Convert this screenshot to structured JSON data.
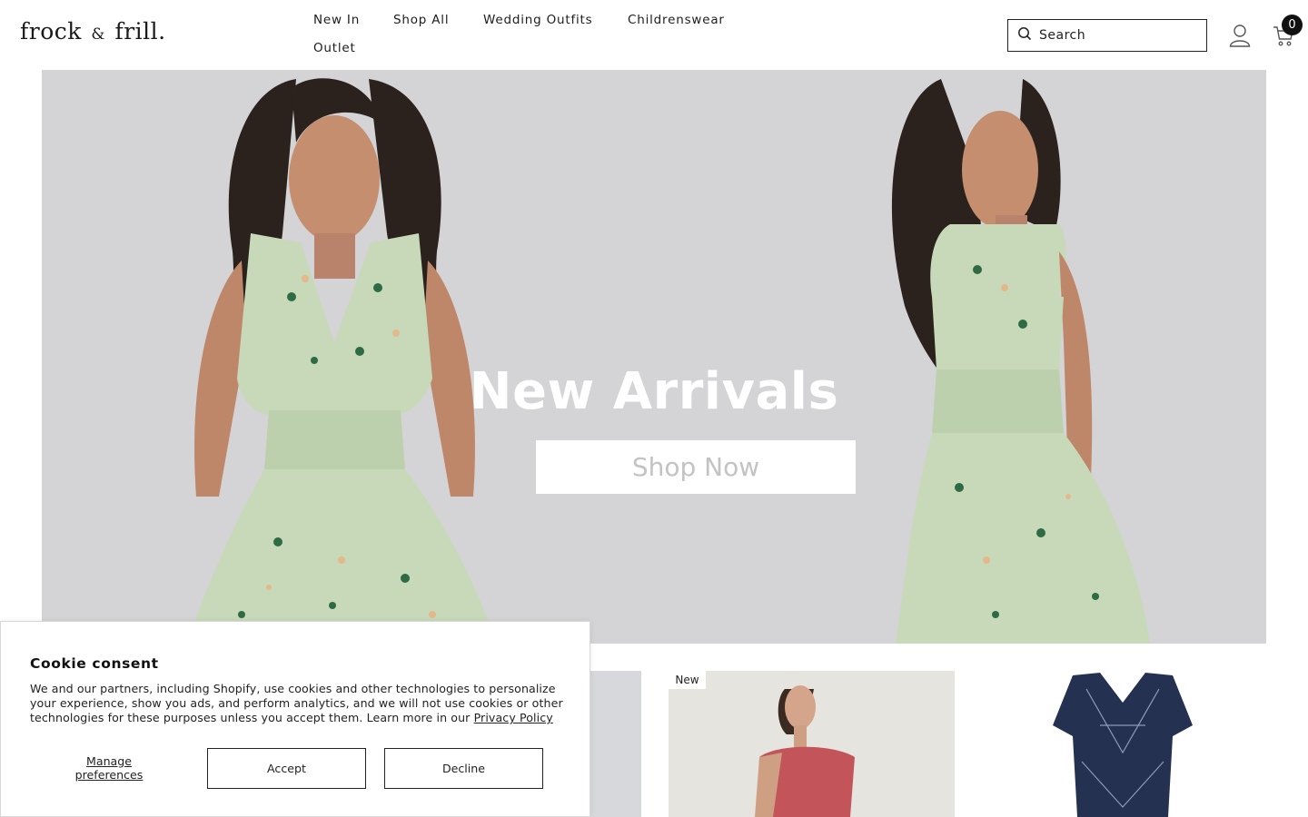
{
  "header": {
    "logo_main": "frock",
    "logo_amp": "&",
    "logo_end": "frill.",
    "nav": [
      {
        "label": "New In"
      },
      {
        "label": "Shop All"
      },
      {
        "label": "Wedding Outfits"
      },
      {
        "label": "Childrenswear"
      },
      {
        "label": "Outlet"
      }
    ],
    "search_placeholder": "Search",
    "cart_count": "0"
  },
  "hero": {
    "title": "New Arrivals",
    "button_label": "Shop Now",
    "background_color": "#d4d4d6",
    "dress_color": "#c7d9b9"
  },
  "products": {
    "badge": "New"
  },
  "cookie": {
    "title": "Cookie consent",
    "text": "We and our partners, including Shopify, use cookies and other technologies to personalize your experience, show you ads, and perform analytics, and we will not use cookies or other technologies for these purposes unless you accept them. Learn more in our",
    "privacy_link": "Privacy Policy",
    "manage_label": "Manage preferences",
    "accept_label": "Accept",
    "decline_label": "Decline"
  }
}
